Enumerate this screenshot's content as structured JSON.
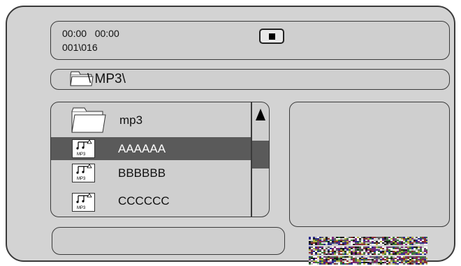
{
  "status": {
    "elapsed_time": "00:00",
    "total_time": "00:00",
    "track_counter": "001\\016",
    "stop_button_icon": "stop-icon"
  },
  "path": {
    "icon": "folder-icon",
    "text": "\\ MP3\\"
  },
  "file_list": {
    "items": [
      {
        "icon": "folder-icon",
        "label": "mp3",
        "selected": false
      },
      {
        "icon": "mp3-file-icon",
        "icon_caption": "MP3",
        "label": "AAAAAA",
        "selected": true
      },
      {
        "icon": "mp3-file-icon",
        "icon_caption": "MP3",
        "label": "BBBBBB",
        "selected": false
      },
      {
        "icon": "mp3-file-icon",
        "icon_caption": "MP3",
        "label": "CCCCCC",
        "selected": false
      }
    ],
    "scroll_up_icon": "triangle-up-icon"
  },
  "colors": {
    "background": "#d3d3d3",
    "selection": "#5a5a5a",
    "border": "#3a3a3a"
  }
}
